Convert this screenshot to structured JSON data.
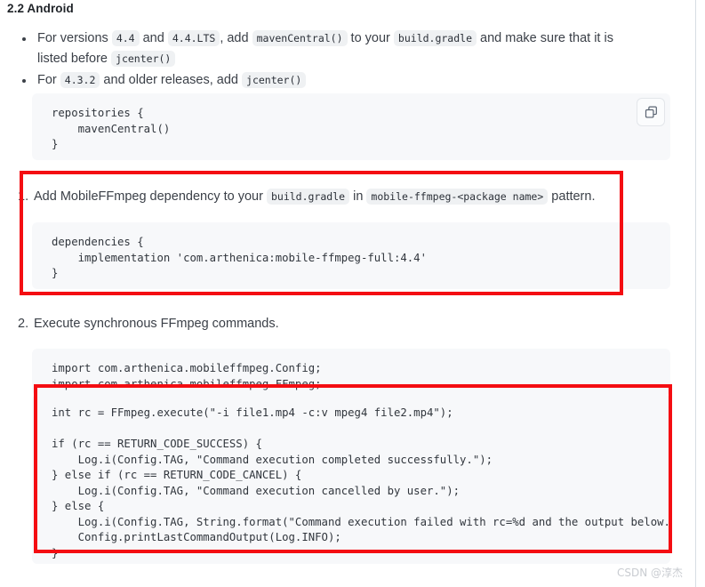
{
  "page": {
    "section_title": "2.2 Android",
    "watermark": "CSDN @淳杰"
  },
  "bullets": [
    {
      "parts": [
        {
          "t": "text",
          "v": "For versions "
        },
        {
          "t": "code",
          "v": "4.4"
        },
        {
          "t": "text",
          "v": " and "
        },
        {
          "t": "code",
          "v": "4.4.LTS"
        },
        {
          "t": "text",
          "v": ", add "
        },
        {
          "t": "code",
          "v": "mavenCentral()"
        },
        {
          "t": "text",
          "v": " to your "
        },
        {
          "t": "code",
          "v": "build.gradle"
        },
        {
          "t": "text",
          "v": " and make sure that it is listed before "
        },
        {
          "t": "code",
          "v": "jcenter()"
        }
      ]
    },
    {
      "parts": [
        {
          "t": "text",
          "v": "For "
        },
        {
          "t": "code",
          "v": "4.3.2"
        },
        {
          "t": "text",
          "v": " and older releases, add "
        },
        {
          "t": "code",
          "v": "jcenter()"
        }
      ]
    }
  ],
  "code_repositories": "repositories {\n    mavenCentral()\n}",
  "ordered_item_1": {
    "number": "1.",
    "parts": [
      {
        "t": "text",
        "v": "Add MobileFFmpeg dependency to your "
      },
      {
        "t": "code",
        "v": "build.gradle"
      },
      {
        "t": "text",
        "v": " in "
      },
      {
        "t": "code",
        "v": "mobile-ffmpeg-<package name>"
      },
      {
        "t": "text",
        "v": " pattern."
      }
    ]
  },
  "code_dependencies": "dependencies {\n    implementation 'com.arthenica:mobile-ffmpeg-full:4.4'\n}",
  "ordered_item_2": {
    "number": "2.",
    "parts": [
      {
        "t": "text",
        "v": "Execute synchronous FFmpeg commands."
      }
    ]
  },
  "code_imports": "import com.arthenica.mobileffmpeg.Config;\nimport com.arthenica.mobileffmpeg.FFmpeg;",
  "code_execute": "int rc = FFmpeg.execute(\"-i file1.mp4 -c:v mpeg4 file2.mp4\");\n\nif (rc == RETURN_CODE_SUCCESS) {\n    Log.i(Config.TAG, \"Command execution completed successfully.\");\n} else if (rc == RETURN_CODE_CANCEL) {\n    Log.i(Config.TAG, \"Command execution cancelled by user.\");\n} else {\n    Log.i(Config.TAG, String.format(\"Command execution failed with rc=%d and the output below.\", rc));\n    Config.printLastCommandOutput(Log.INFO);\n}",
  "icons": {
    "copy": "copy-icon"
  },
  "colors": {
    "annotation_red": "#f40d12",
    "code_background": "#f7f8fa",
    "chip_background": "#eff1f3",
    "text": "#3b4048"
  }
}
